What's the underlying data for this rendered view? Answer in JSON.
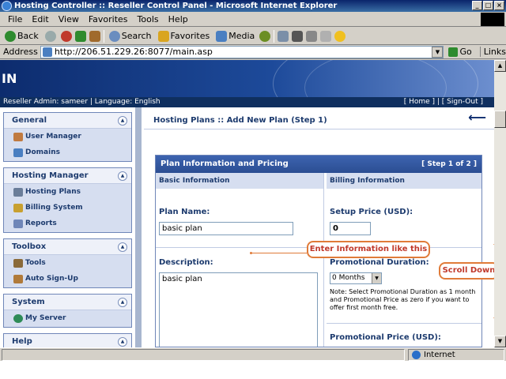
{
  "window": {
    "title": "Hosting Controller :: Reseller Control Panel - Microsoft Internet Explorer"
  },
  "menu": [
    "File",
    "Edit",
    "View",
    "Favorites",
    "Tools",
    "Help"
  ],
  "toolbar": {
    "back": "Back",
    "search": "Search",
    "favorites": "Favorites",
    "media": "Media"
  },
  "address": {
    "label": "Address",
    "url": "http://206.51.229.26:8077/main.asp",
    "go": "Go",
    "links": "Links"
  },
  "banner": {
    "logo": "IN"
  },
  "userbar": {
    "left": "Reseller Admin: sameer | Language: English",
    "home": "[ Home ]",
    "sep": " | ",
    "signout": "[ Sign-Out ]"
  },
  "sidebar": {
    "panels": [
      {
        "title": "General",
        "items": [
          "User Manager",
          "Domains"
        ]
      },
      {
        "title": "Hosting Manager",
        "items": [
          "Hosting Plans",
          "Billing System",
          "Reports"
        ]
      },
      {
        "title": "Toolbox",
        "items": [
          "Tools",
          "Auto Sign-Up"
        ]
      },
      {
        "title": "System",
        "items": [
          "My Server"
        ]
      },
      {
        "title": "Help",
        "items": []
      }
    ]
  },
  "main": {
    "header": "Hosting Plans :: Add New Plan (Step 1)",
    "box": {
      "title": "Plan Information and Pricing",
      "step": "[ Step 1 of 2 ]",
      "left_heading": "Basic Information",
      "right_heading": "Billing Information",
      "plan_name_label": "Plan Name:",
      "plan_name_value": "basic plan",
      "description_label": "Description:",
      "description_value": "basic plan",
      "setup_price_label": "Setup Price (USD):",
      "setup_price_value": "0",
      "promo_duration_label": "Promotional Duration:",
      "promo_duration_value": "0 Months",
      "promo_note": "Note: Select Promotional Duration as 1 month and Promotional Price as zero if you want to offer first month free.",
      "promo_price_label": "Promotional Price (USD):"
    }
  },
  "annotations": {
    "enter_info": "Enter Information like this",
    "scroll_down": "Scroll Down"
  },
  "status": {
    "zone": "Internet"
  }
}
